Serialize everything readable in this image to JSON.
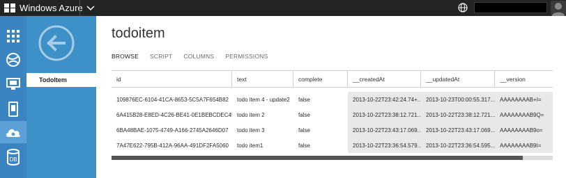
{
  "topbar": {
    "brand": "Windows Azure",
    "icons": [
      "windows-logo-icon",
      "chevron-down-icon",
      "globe-icon",
      "user-avatar-icon"
    ]
  },
  "leftnav": {
    "items": [
      {
        "name": "all-items",
        "icon": "grid-icon"
      },
      {
        "name": "web-sites",
        "icon": "globe-network-icon"
      },
      {
        "name": "virtual-machines",
        "icon": "monitor-icon"
      },
      {
        "name": "mobile-services",
        "icon": "mobile-icon"
      },
      {
        "name": "cloud-services",
        "icon": "cloud-gear-icon"
      },
      {
        "name": "sql-databases",
        "icon": "database-icon",
        "label": "DB"
      }
    ]
  },
  "subnav": {
    "item_label": "TodoItem"
  },
  "main": {
    "title": "todoitem",
    "tabs": [
      {
        "label": "BROWSE",
        "active": true
      },
      {
        "label": "SCRIPT",
        "active": false
      },
      {
        "label": "COLUMNS",
        "active": false
      },
      {
        "label": "PERMISSIONS",
        "active": false
      }
    ],
    "table": {
      "columns": [
        "id",
        "text",
        "complete",
        "__createdAt",
        "__updatedAt",
        "__version"
      ],
      "rows": [
        [
          "109876EC-6104-41CA-8653-5C5A7F654B82",
          "todo item 4 - update2",
          "false",
          "2013-10-22T23:42:24.74+...",
          "2013-10-23T00:00:55.317...",
          "AAAAAAAAB+I="
        ],
        [
          "6A415B28-E8ED-4C26-BE41-0E1BEBCDEC45",
          "todo item 2",
          "false",
          "2013-10-22T23:38:12.721...",
          "2013-10-22T23:38:12.721...",
          "AAAAAAAAB9Q="
        ],
        [
          "6BA48BAE-1075-4749-A166-2745A2646D07",
          "todo item 3",
          "false",
          "2013-10-22T23:43:17.069...",
          "2013-10-22T23:43:17.069...",
          "AAAAAAAAB9o="
        ],
        [
          "7A47E622-795B-412A-96AA-491DF2FA5060",
          "todo item1",
          "false",
          "2013-10-22T23:36:54.579...",
          "2013-10-22T23:36:54.595...",
          "AAAAAAAAB9I="
        ]
      ]
    },
    "scroll_fraction_visible": 0.93
  },
  "colors": {
    "topbar": "#242424",
    "leftnav": "#3b84c2",
    "subnav": "#3d90c8",
    "readonly_cell": "#e8e8e8"
  }
}
